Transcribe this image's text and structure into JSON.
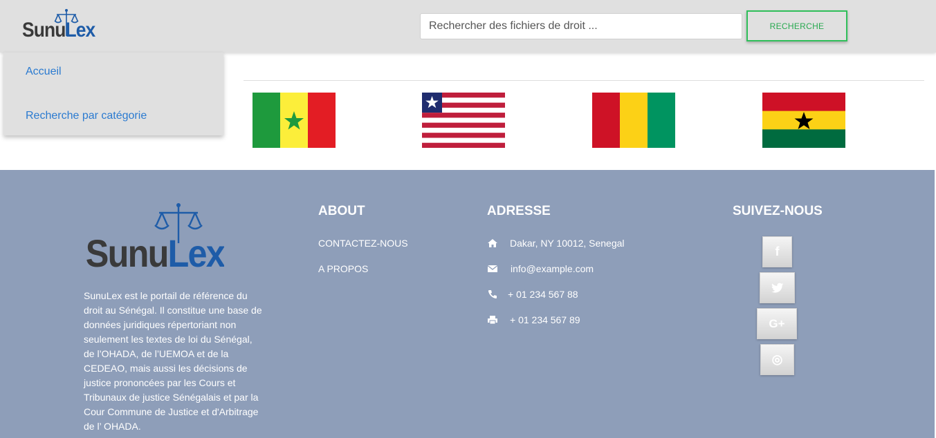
{
  "header": {
    "logo": {
      "part1": "Sunu",
      "part2": "Lex"
    },
    "search": {
      "placeholder": "Rechercher des fichiers de droit ...",
      "value": ""
    },
    "search_button_label": "RECHERCHE"
  },
  "menu": {
    "items": [
      {
        "label": "Accueil"
      },
      {
        "label": "Recherche par catégorie"
      }
    ]
  },
  "flags": [
    {
      "country": "Senegal"
    },
    {
      "country": "Liberia"
    },
    {
      "country": "Guinea"
    },
    {
      "country": "Ghana"
    }
  ],
  "footer": {
    "logo": {
      "part1": "Sunu",
      "part2": "Lex"
    },
    "description": "SunuLex est le portail de référence du droit au Sénégal. Il constitue une base de données juridiques répertoriant non seulement les textes de loi du Sénégal, de l’OHADA, de l’UEMOA et de la CEDEAO, mais aussi les décisions de justice prononcées par les Cours et Tribunaux de justice Sénégalais et par la Cour Commune de Justice et d'Arbitrage de l’ OHADA.",
    "about": {
      "title": "ABOUT",
      "links": [
        "CONTACTEZ-NOUS",
        "A PROPOS"
      ]
    },
    "address": {
      "title": "ADRESSE",
      "items": [
        {
          "icon": "home-icon",
          "text": "Dakar, NY 10012, Senegal"
        },
        {
          "icon": "envelope-icon",
          "text": "info@example.com"
        },
        {
          "icon": "phone-icon",
          "text": "+ 01 234 567 88"
        },
        {
          "icon": "printer-icon",
          "text": "+ 01 234 567 89"
        }
      ]
    },
    "social": {
      "title": "SUIVEZ-NOUS",
      "items": [
        {
          "icon": "facebook-icon",
          "glyph": "f"
        },
        {
          "icon": "twitter-icon",
          "glyph": "🐦"
        },
        {
          "icon": "google-plus-icon",
          "glyph": "G+"
        },
        {
          "icon": "dribbble-icon",
          "glyph": "◎"
        }
      ]
    }
  },
  "colors": {
    "header_bg": "#e0e0e0",
    "footer_bg": "#8e9eb9",
    "link": "#2a7ad0",
    "accent_green": "#2fbf5a",
    "logo_blue": "#1e5ca8"
  }
}
